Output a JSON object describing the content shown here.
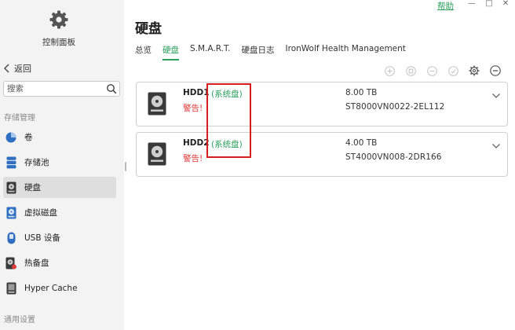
{
  "window": {
    "help_label": "帮助",
    "minimize_glyph": "—",
    "maximize_glyph": "□",
    "close_glyph": "✕"
  },
  "sidebar": {
    "header_label": "控制面板",
    "back_label": "返回",
    "search_placeholder": "搜索",
    "section_storage": "存储管理",
    "section_general": "通用设置",
    "items": [
      {
        "label": "卷",
        "icon": "volume-pie-icon"
      },
      {
        "label": "存储池",
        "icon": "storage-pool-icon"
      },
      {
        "label": "硬盘",
        "icon": "hard-disk-icon",
        "active": true
      },
      {
        "label": "虚拟磁盘",
        "icon": "virtual-disk-icon"
      },
      {
        "label": "USB 设备",
        "icon": "usb-device-icon"
      },
      {
        "label": "热备盘",
        "icon": "hot-spare-icon"
      },
      {
        "label": "Hyper Cache",
        "icon": "hyper-cache-icon"
      }
    ]
  },
  "main": {
    "title": "硬盘",
    "tabs": [
      {
        "label": "总览"
      },
      {
        "label": "硬盘",
        "active": true
      },
      {
        "label": "S.M.A.R.T."
      },
      {
        "label": "硬盘日志"
      },
      {
        "label": "IronWolf Health Management"
      }
    ],
    "toolbar_icons": [
      "add-circle-icon",
      "info-circle-icon",
      "remove-circle-icon",
      "check-circle-icon",
      "settings-gear-icon",
      "more-circle-icon"
    ],
    "disks": [
      {
        "name": "HDD1",
        "tag": "(系统盘)",
        "status": "警告!",
        "capacity": "8.00 TB",
        "model": "ST8000VN0022-2EL112"
      },
      {
        "name": "HDD2",
        "tag": "(系统盘)",
        "status": "警告!",
        "capacity": "4.00 TB",
        "model": "ST4000VN008-2DR166"
      }
    ]
  },
  "colors": {
    "accent_green": "#2aa05c",
    "warning_red": "#e03a3a",
    "highlight_red": "#d81c1c"
  }
}
